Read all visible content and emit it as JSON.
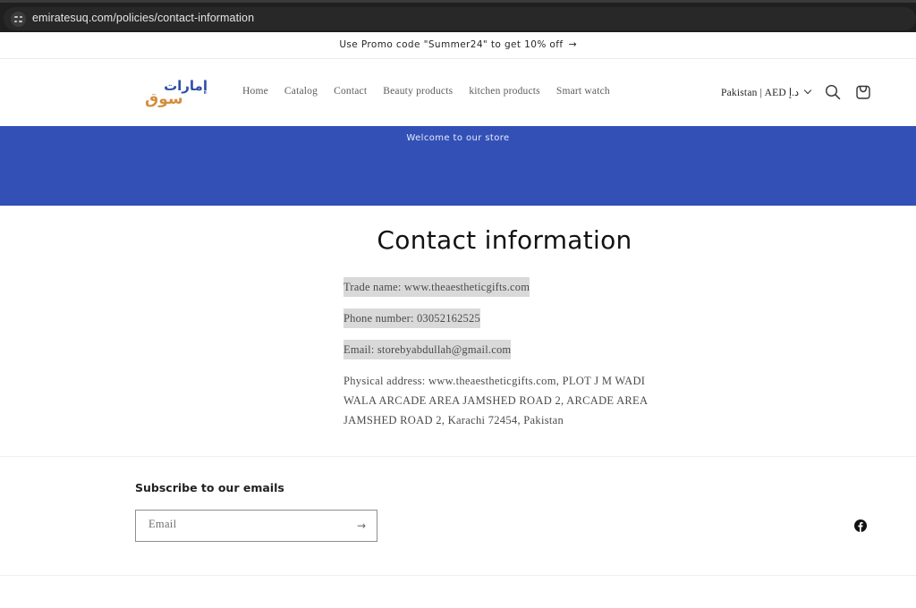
{
  "browser": {
    "url": "emiratesuq.com/policies/contact-information",
    "site_icon": "site-settings-icon"
  },
  "announcement": {
    "text": "Use Promo code \"Summer24\" to get 10% off",
    "arrow": "→"
  },
  "header": {
    "logo": {
      "top_text": "إمارات",
      "bottom_text": "سوق",
      "colors": {
        "top": "#2d4fa6",
        "bottom": "#d48d3f"
      }
    },
    "nav": [
      {
        "label": "Home"
      },
      {
        "label": "Catalog"
      },
      {
        "label": "Contact"
      },
      {
        "label": "Beauty products"
      },
      {
        "label": "kitchen products"
      },
      {
        "label": "Smart watch"
      }
    ],
    "locale": "Pakistan | AED د.إ",
    "icons": [
      "search-icon",
      "cart-icon"
    ]
  },
  "hero": {
    "text": "Welcome to our store",
    "background": "#3350b7"
  },
  "main": {
    "title": "Contact information",
    "trade_name": "Trade name: www.theaestheticgifts.com",
    "phone": "Phone number: 03052162525",
    "email": "Email: storebyabdullah@gmail.com",
    "address_lines": [
      "Physical address: www.theaestheticgifts.com, PLOT J M WADI",
      "WALA ARCADE AREA JAMSHED ROAD 2, ARCADE AREA",
      "JAMSHED ROAD 2, Karachi 72454, Pakistan"
    ]
  },
  "footer": {
    "subscribe_title": "Subscribe to our emails",
    "email_placeholder": "Email",
    "submit_arrow": "→",
    "social": [
      "facebook-icon"
    ]
  }
}
